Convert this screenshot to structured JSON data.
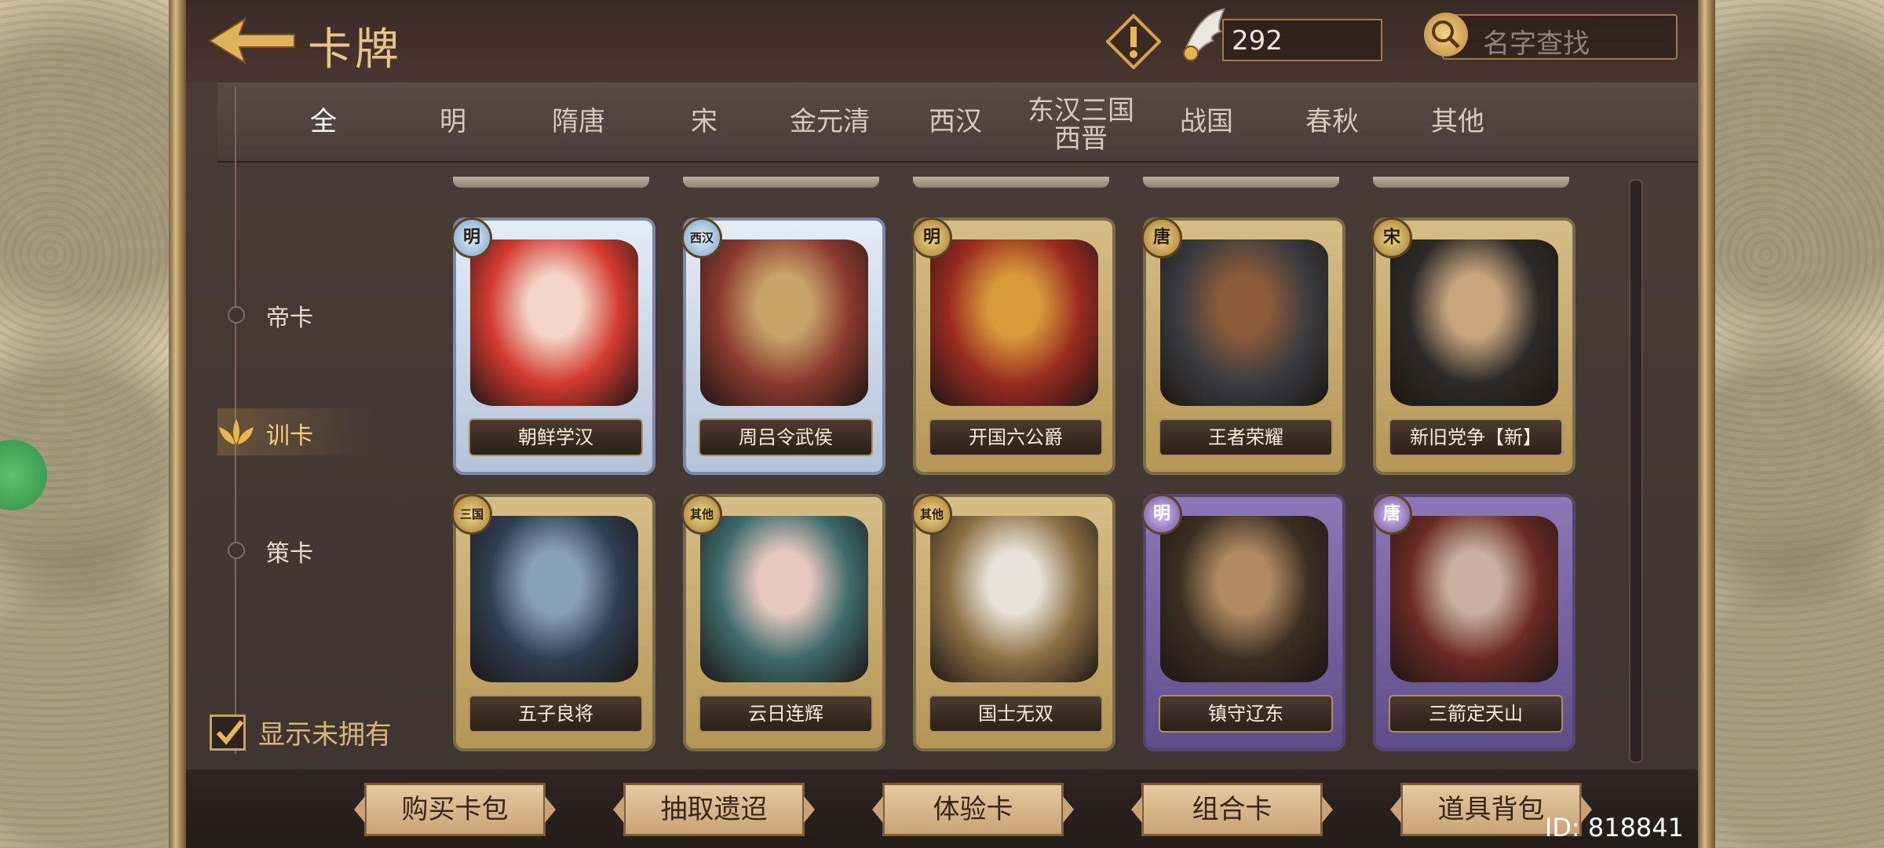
{
  "header": {
    "title": "卡牌",
    "resource_count": "292",
    "search_placeholder": "名字查找"
  },
  "tabs": [
    "全",
    "明",
    "隋唐",
    "宋",
    "金元清",
    "西汉",
    "东汉三国\n西晋",
    "战国",
    "春秋",
    "其他"
  ],
  "active_tab": "全",
  "side_nav": [
    {
      "label": "帝卡",
      "active": false
    },
    {
      "label": "训卡",
      "active": true
    },
    {
      "label": "策卡",
      "active": false
    }
  ],
  "cards": [
    {
      "name": "朝鲜学汉",
      "badge": "明",
      "style": "blue",
      "colors": [
        "#d33a2f",
        "#f3d6c8"
      ]
    },
    {
      "name": "周吕令武侯",
      "badge": "西汉",
      "style": "blue",
      "colors": [
        "#8b3b2f",
        "#c9a46a"
      ]
    },
    {
      "name": "开国六公爵",
      "badge": "明",
      "style": "gold",
      "colors": [
        "#9a2b20",
        "#d89a3a"
      ]
    },
    {
      "name": "王者荣耀",
      "badge": "唐",
      "style": "gold",
      "colors": [
        "#3b3c3f",
        "#8a5a3a"
      ]
    },
    {
      "name": "新旧党争【新】",
      "badge": "宋",
      "style": "gold",
      "colors": [
        "#2c2a28",
        "#c9a57e"
      ]
    },
    {
      "name": "五子良将",
      "badge": "三国",
      "style": "gold",
      "colors": [
        "#2e3e52",
        "#8aa2b8"
      ]
    },
    {
      "name": "云日连辉",
      "badge": "其他",
      "style": "gold",
      "colors": [
        "#3d6b6a",
        "#e6c8c0"
      ]
    },
    {
      "name": "国士无双",
      "badge": "其他",
      "style": "gold",
      "colors": [
        "#8c7044",
        "#e8e2d8"
      ]
    },
    {
      "name": "镇守辽东",
      "badge": "明",
      "style": "purple",
      "colors": [
        "#3b2e22",
        "#b08a62"
      ]
    },
    {
      "name": "三箭定天山",
      "badge": "唐",
      "style": "purple",
      "colors": [
        "#6a2a24",
        "#c9b0a0"
      ]
    }
  ],
  "show_unowned": {
    "label": "显示未拥有",
    "checked": true
  },
  "bottom_buttons": [
    "购买卡包",
    "抽取遗迢",
    "体验卡",
    "组合卡",
    "道具背包"
  ],
  "player_id": "ID: 818841"
}
